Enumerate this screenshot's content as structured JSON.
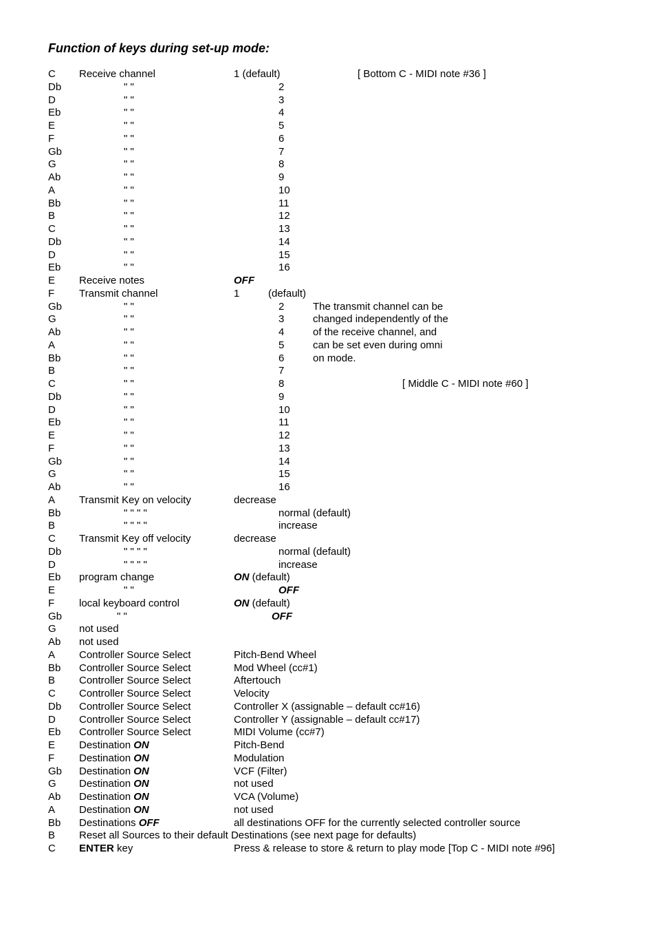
{
  "heading": "Function of keys during set-up mode:",
  "ditto2": "\" \"",
  "ditto4": "\" \" \" \"",
  "ditto_l": "\"  \"",
  "rows": [
    {
      "key": "C",
      "item": "Receive channel",
      "val": "1 (default)",
      "desc": "[ Bottom C - MIDI note #36 ]",
      "descClass": "right-note"
    },
    {
      "key": "Db",
      "item_ditto": 2,
      "val": "2"
    },
    {
      "key": "D",
      "item_ditto": 2,
      "val": "3"
    },
    {
      "key": "Eb",
      "item_ditto": 2,
      "val": "4"
    },
    {
      "key": "E",
      "item_ditto": 2,
      "val": "5"
    },
    {
      "key": "F",
      "item_ditto": 2,
      "val": "6"
    },
    {
      "key": "Gb",
      "item_ditto": 2,
      "val": "7"
    },
    {
      "key": "G",
      "item_ditto": 2,
      "val": "8"
    },
    {
      "key": "Ab",
      "item_ditto": 2,
      "val": "9"
    },
    {
      "key": "A",
      "item_ditto": 2,
      "val": "10"
    },
    {
      "key": "Bb",
      "item_ditto": 2,
      "val": "11"
    },
    {
      "key": "B",
      "item_ditto": 2,
      "val": "12"
    },
    {
      "key": "C",
      "item_ditto": 2,
      "val": "13"
    },
    {
      "key": "Db",
      "item_ditto": 2,
      "val": "14"
    },
    {
      "key": "D",
      "item_ditto": 2,
      "val": "15"
    },
    {
      "key": "Eb",
      "item_ditto": 2,
      "val": "16"
    },
    {
      "key": "E",
      "item": "Receive notes",
      "val_boldit": "OFF"
    },
    {
      "key": "F",
      "item": "Transmit channel",
      "val": "1",
      "desc": "(default)"
    },
    {
      "key": "Gb",
      "item_ditto": 2,
      "val": "2",
      "desc": "The transmit channel can be"
    },
    {
      "key": "G",
      "item_ditto": 2,
      "val": "3",
      "desc": "changed independently of the"
    },
    {
      "key": "Ab",
      "item_ditto": 2,
      "val": "4",
      "desc": "of the receive channel, and"
    },
    {
      "key": "A",
      "item_ditto": 2,
      "val": "5",
      "desc": "can be set even during omni"
    },
    {
      "key": "Bb",
      "item_ditto": 2,
      "val": "6",
      "desc": "on mode."
    },
    {
      "key": "B",
      "item_ditto": 2,
      "val": "7"
    },
    {
      "key": "C",
      "item_ditto": 2,
      "val": "8",
      "desc": "[ Middle C - MIDI note #60 ]",
      "descClass": "right-note"
    },
    {
      "key": "Db",
      "item_ditto": 2,
      "val": "9"
    },
    {
      "key": "D",
      "item_ditto": 2,
      "val": "10"
    },
    {
      "key": "Eb",
      "item_ditto": 2,
      "val": "11"
    },
    {
      "key": "E",
      "item_ditto": 2,
      "val": "12"
    },
    {
      "key": "F",
      "item_ditto": 2,
      "val": "13"
    },
    {
      "key": "Gb",
      "item_ditto": 2,
      "val": "14"
    },
    {
      "key": "G",
      "item_ditto": 2,
      "val": "15"
    },
    {
      "key": "Ab",
      "item_ditto": 2,
      "val": "16"
    },
    {
      "key": "A",
      "item": "Transmit Key on velocity",
      "val_wide": "decrease"
    },
    {
      "key": "Bb",
      "item_ditto": 4,
      "val_wide": "normal (default)"
    },
    {
      "key": "B",
      "item_ditto": 4,
      "val_wide": "increase"
    },
    {
      "key": "C",
      "item": "Transmit Key off velocity",
      "val_wide": "decrease"
    },
    {
      "key": "Db",
      "item_ditto": 4,
      "val_wide": "normal (default)"
    },
    {
      "key": "D",
      "item_ditto": 4,
      "val_wide": "increase"
    },
    {
      "key": "Eb",
      "item": "program change",
      "val_wide_markup": "<span class=\"boldit\">ON</span> (default)"
    },
    {
      "key": "E",
      "item_ditto": 2,
      "val_wide_boldit": "OFF"
    },
    {
      "key": "F",
      "item": "local keyboard control",
      "val_wide_markup": "<span class=\"boldit\">ON</span> (default)"
    },
    {
      "key": "Gb",
      "item_ditto": "l",
      "val_wide_boldit": "OFF"
    },
    {
      "key": "G",
      "item": "not used"
    },
    {
      "key": "Ab",
      "item": "not used"
    },
    {
      "key": "A",
      "item": "Controller Source Select",
      "val_wide": "Pitch-Bend Wheel"
    },
    {
      "key": "Bb",
      "item": "Controller Source Select",
      "val_wide": "Mod Wheel (cc#1)"
    },
    {
      "key": "B",
      "item": "Controller Source Select",
      "val_wide": "Aftertouch"
    },
    {
      "key": "C",
      "item": "Controller Source Select",
      "val_wide": "Velocity"
    },
    {
      "key": "Db",
      "item": "Controller Source Select",
      "val_wide": "Controller X (assignable – default cc#16)"
    },
    {
      "key": "D",
      "item": "Controller Source Select",
      "val_wide": "Controller Y (assignable – default cc#17)"
    },
    {
      "key": "Eb",
      "item": "Controller Source Select",
      "val_wide": "MIDI Volume (cc#7)"
    },
    {
      "key": "E",
      "item_markup": "Destination <span class=\"boldit\">ON</span>",
      "val_wide": "Pitch-Bend"
    },
    {
      "key": "F",
      "item_markup": "Destination <span class=\"boldit\">ON</span>",
      "val_wide": "Modulation"
    },
    {
      "key": "Gb",
      "item_markup": "Destination <span class=\"boldit\">ON</span>",
      "val_wide": "VCF (Filter)"
    },
    {
      "key": "G",
      "item_markup": "Destination <span class=\"boldit\">ON</span>",
      "val_wide": "not used"
    },
    {
      "key": "Ab",
      "item_markup": "Destination <span class=\"boldit\">ON</span>",
      "val_wide": "VCA (Volume)"
    },
    {
      "key": "A",
      "item_markup": "Destination <span class=\"boldit\">ON</span>",
      "val_wide": "not used"
    },
    {
      "key": "Bb",
      "item_markup": "Destinations <span class=\"boldit\">OFF</span>",
      "val_wide": "all destinations OFF for the currently selected controller source"
    },
    {
      "key": "B",
      "item_full": "Reset all Sources to their default Destinations (see next page for defaults)"
    },
    {
      "key": "C",
      "item_markup": "<span class=\"bold\">ENTER</span> key",
      "val_wide": "Press & release to store & return to play mode [Top C - MIDI note #96]"
    }
  ]
}
